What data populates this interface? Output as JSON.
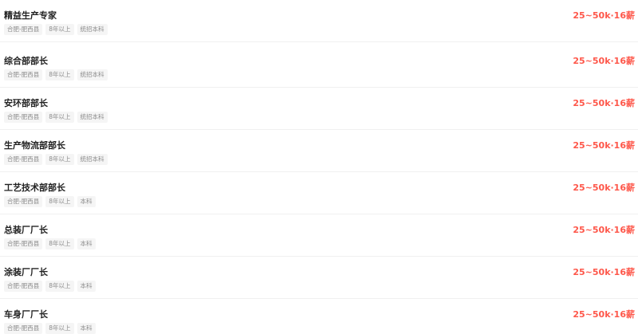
{
  "colors": {
    "salary": "#fe574a",
    "title": "#222222",
    "tag_text": "#8c8c8c",
    "tag_bg": "#f5f5f5",
    "divider": "#f0f0f0"
  },
  "jobs": [
    {
      "title": "精益生产专家",
      "tags": [
        "合肥-肥西县",
        "8年以上",
        "统招本科"
      ],
      "salary": "25~50k·16薪"
    },
    {
      "title": "综合部部长",
      "tags": [
        "合肥-肥西县",
        "8年以上",
        "统招本科"
      ],
      "salary": "25~50k·16薪"
    },
    {
      "title": "安环部部长",
      "tags": [
        "合肥-肥西县",
        "8年以上",
        "统招本科"
      ],
      "salary": "25~50k·16薪"
    },
    {
      "title": "生产物流部部长",
      "tags": [
        "合肥-肥西县",
        "8年以上",
        "统招本科"
      ],
      "salary": "25~50k·16薪"
    },
    {
      "title": "工艺技术部部长",
      "tags": [
        "合肥-肥西县",
        "8年以上",
        "本科"
      ],
      "salary": "25~50k·16薪"
    },
    {
      "title": "总装厂厂长",
      "tags": [
        "合肥-肥西县",
        "8年以上",
        "本科"
      ],
      "salary": "25~50k·16薪"
    },
    {
      "title": "涂装厂厂长",
      "tags": [
        "合肥-肥西县",
        "8年以上",
        "本科"
      ],
      "salary": "25~50k·16薪"
    },
    {
      "title": "车身厂厂长",
      "tags": [
        "合肥-肥西县",
        "8年以上",
        "本科"
      ],
      "salary": "25~50k·16薪"
    }
  ]
}
